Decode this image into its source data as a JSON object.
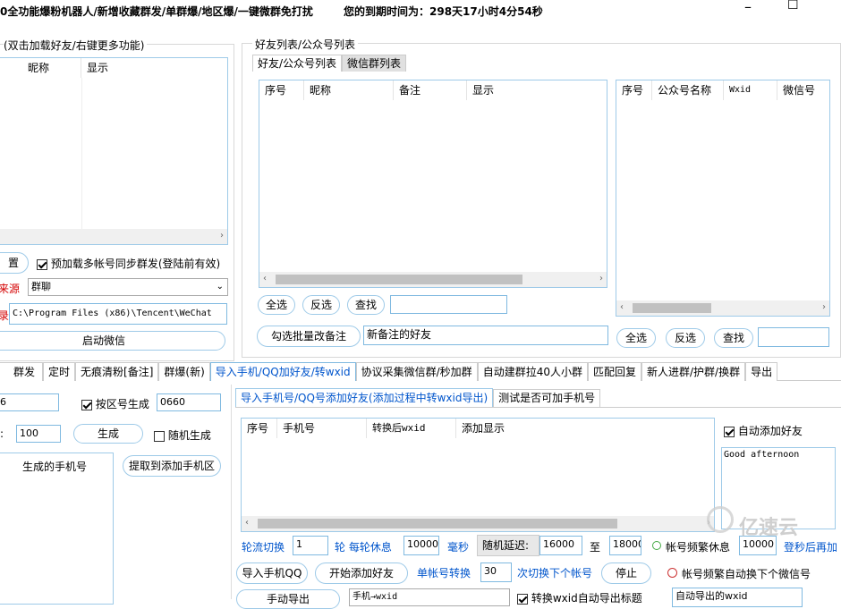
{
  "title_bar": {
    "app_title": "0全功能爆粉机器人/新增收藏群发/单群爆/地区爆/一键微群免打扰",
    "expiry": "您的到期时间为：298天17小时4分54秒",
    "minimize": "–",
    "maximize": "☐"
  },
  "left_panel": {
    "group_title": "(双击加载好友/右键更多功能)",
    "columns": [
      "昵称",
      "显示"
    ],
    "setup_button": "置",
    "preload_checkbox": "预加载多帐号同步群发(登陆前有效)",
    "source_label": "来源",
    "source_select": "群聊",
    "path_label": "录",
    "wechat_path": "C:\\Program Files (x86)\\Tencent\\WeChat",
    "start_button": "启动微信"
  },
  "friends_panel": {
    "group_title": "好友列表/公众号列表",
    "tabs": [
      "好友/公众号列表",
      "微信群列表"
    ],
    "friend_columns": [
      "序号",
      "昵称",
      "备注",
      "显示"
    ],
    "official_columns": [
      "序号",
      "公众号名称",
      "Wxid",
      "微信号"
    ],
    "select_all": "全选",
    "invert": "反选",
    "search": "查找",
    "remark_button": "勾选批量改备注",
    "remark_input": "新备注的好友",
    "select_all_2": "全选",
    "invert_2": "反选",
    "search_2": "查找"
  },
  "main_tabs": [
    "群发",
    "定时",
    "无痕清粉[备注]",
    "群爆(新)",
    "导入手机/QQ加好友/转wxid",
    "协议采集微信群/秒加群",
    "自动建群拉40人小群",
    "匹配回复",
    "新人进群/护群/换群",
    "导出"
  ],
  "phone_gen": {
    "prefix_value": "6",
    "area_checkbox": "按区号生成",
    "area_value": "0660",
    "count_label": ":",
    "count_value": "100",
    "gen_button": "生成",
    "random_checkbox": "随机生成",
    "list_header": "生成的手机号",
    "extract_button": "提取到添加手机区"
  },
  "import_section": {
    "subtabs": [
      "导入手机号/QQ号添加好友(添加过程中转wxid导出)",
      "测试是否可加手机号"
    ],
    "columns": [
      "序号",
      "手机号",
      "转换后wxid",
      "添加显示"
    ],
    "auto_add": "自动添加好友",
    "greeting": "Good afternoon",
    "rotate_label": "轮流切换",
    "rotate_value": "1",
    "round_label": "轮 每轮休息",
    "rest_value": "10000",
    "ms_label": "毫秒",
    "delay_label": "随机延迟:",
    "delay_min": "16000",
    "to_label": "至",
    "delay_max": "18000",
    "freq_label": "帐号频繁休息",
    "freq_value": "10000",
    "login_label": "登秒后再加",
    "import_btn": "导入手机QQ",
    "start_btn": "开始添加好友",
    "single_label": "单帐号转换",
    "single_value": "30",
    "switch_label": "次切换下个帐号",
    "stop_btn": "停止",
    "auto_switch": "帐号频繁自动换下个微信号",
    "export_btn": "手动导出",
    "select_value": "手机→wxid",
    "convert_label": "转换wxid自动导出标题",
    "auto_export": "自动导出的wxid"
  },
  "watermark": "亿速云"
}
